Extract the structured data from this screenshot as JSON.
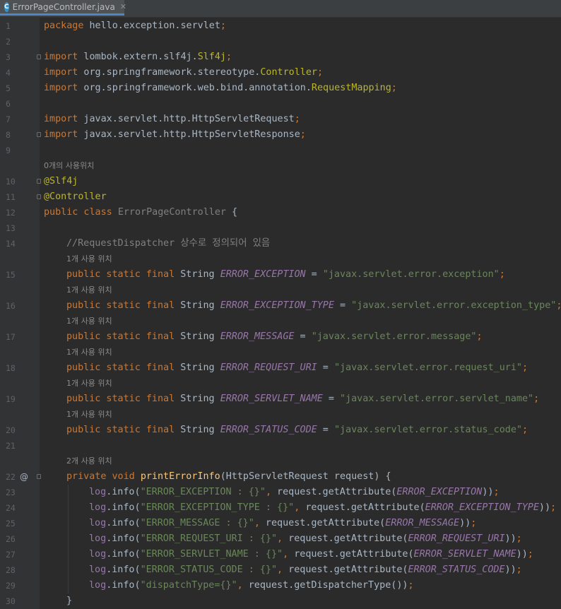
{
  "tab": {
    "filename": "ErrorPageController.java",
    "icon_letter": "C",
    "close_glyph": "✕"
  },
  "colors": {
    "editor_bg": "#2b2b2b",
    "keyword": "#cc7832",
    "string": "#6a8759",
    "constant": "#9876aa",
    "method": "#ffc66d",
    "annotation": "#bbb529"
  },
  "lines": [
    {
      "ln": "1",
      "tokens": [
        [
          "kw",
          "package"
        ],
        [
          "p",
          " hello.exception.servlet"
        ],
        [
          "kw",
          ";"
        ]
      ]
    },
    {
      "ln": "2",
      "tokens": []
    },
    {
      "ln": "3",
      "fold": true,
      "tokens": [
        [
          "kw",
          "import"
        ],
        [
          "p",
          " lombok.extern.slf4j."
        ],
        [
          "ann",
          "Slf4j"
        ],
        [
          "kw",
          ";"
        ]
      ]
    },
    {
      "ln": "4",
      "tokens": [
        [
          "kw",
          "import"
        ],
        [
          "p",
          " org.springframework.stereotype."
        ],
        [
          "ann",
          "Controller"
        ],
        [
          "kw",
          ";"
        ]
      ]
    },
    {
      "ln": "5",
      "tokens": [
        [
          "kw",
          "import"
        ],
        [
          "p",
          " org.springframework.web.bind.annotation."
        ],
        [
          "ann",
          "RequestMapping"
        ],
        [
          "kw",
          ";"
        ]
      ]
    },
    {
      "ln": "6",
      "tokens": []
    },
    {
      "ln": "7",
      "tokens": [
        [
          "kw",
          "import"
        ],
        [
          "p",
          " javax.servlet.http.HttpServletRequest"
        ],
        [
          "kw",
          ";"
        ]
      ]
    },
    {
      "ln": "8",
      "fold": true,
      "tokens": [
        [
          "kw",
          "import"
        ],
        [
          "p",
          " javax.servlet.http.HttpServletResponse"
        ],
        [
          "kw",
          ";"
        ]
      ]
    },
    {
      "ln": "9",
      "tokens": []
    },
    {
      "hint": "0개의 사용위치"
    },
    {
      "ln": "10",
      "fold": true,
      "tokens": [
        [
          "ann",
          "@Slf4j"
        ]
      ]
    },
    {
      "ln": "11",
      "fold": true,
      "tokens": [
        [
          "ann",
          "@Controller"
        ]
      ]
    },
    {
      "ln": "12",
      "tokens": [
        [
          "kw",
          "public class"
        ],
        [
          "p",
          " "
        ],
        [
          "dim",
          "ErrorPageController"
        ],
        [
          "p",
          " {"
        ]
      ]
    },
    {
      "ln": "13",
      "tokens": []
    },
    {
      "ln": "14",
      "indent": 1,
      "tokens": [
        [
          "cm",
          "//RequestDispatcher 상수로 정의되어 있음"
        ]
      ]
    },
    {
      "hint": "1개 사용 위치",
      "indent": 1
    },
    {
      "ln": "15",
      "indent": 1,
      "tokens": [
        [
          "kw",
          "public static final"
        ],
        [
          "p",
          " String "
        ],
        [
          "const",
          "ERROR_EXCEPTION"
        ],
        [
          "p",
          " = "
        ],
        [
          "str",
          "\"javax.servlet.error.exception\""
        ],
        [
          "kw",
          ";"
        ]
      ]
    },
    {
      "hint": "1개 사용 위치",
      "indent": 1
    },
    {
      "ln": "16",
      "indent": 1,
      "tokens": [
        [
          "kw",
          "public static final"
        ],
        [
          "p",
          " String "
        ],
        [
          "const",
          "ERROR_EXCEPTION_TYPE"
        ],
        [
          "p",
          " = "
        ],
        [
          "str",
          "\"javax.servlet.error.exception_type\""
        ],
        [
          "kw",
          ";"
        ]
      ]
    },
    {
      "hint": "1개 사용 위치",
      "indent": 1
    },
    {
      "ln": "17",
      "indent": 1,
      "tokens": [
        [
          "kw",
          "public static final"
        ],
        [
          "p",
          " String "
        ],
        [
          "const",
          "ERROR_MESSAGE"
        ],
        [
          "p",
          " = "
        ],
        [
          "str",
          "\"javax.servlet.error.message\""
        ],
        [
          "kw",
          ";"
        ]
      ]
    },
    {
      "hint": "1개 사용 위치",
      "indent": 1
    },
    {
      "ln": "18",
      "indent": 1,
      "tokens": [
        [
          "kw",
          "public static final"
        ],
        [
          "p",
          " String "
        ],
        [
          "const",
          "ERROR_REQUEST_URI"
        ],
        [
          "p",
          " = "
        ],
        [
          "str",
          "\"javax.servlet.error.request_uri\""
        ],
        [
          "kw",
          ";"
        ]
      ]
    },
    {
      "hint": "1개 사용 위치",
      "indent": 1
    },
    {
      "ln": "19",
      "indent": 1,
      "tokens": [
        [
          "kw",
          "public static final"
        ],
        [
          "p",
          " String "
        ],
        [
          "const",
          "ERROR_SERVLET_NAME"
        ],
        [
          "p",
          " = "
        ],
        [
          "str",
          "\"javax.servlet.error.servlet_name\""
        ],
        [
          "kw",
          ";"
        ]
      ]
    },
    {
      "hint": "1개 사용 위치",
      "indent": 1
    },
    {
      "ln": "20",
      "indent": 1,
      "tokens": [
        [
          "kw",
          "public static final"
        ],
        [
          "p",
          " String "
        ],
        [
          "const",
          "ERROR_STATUS_CODE"
        ],
        [
          "p",
          " = "
        ],
        [
          "str",
          "\"javax.servlet.error.status_code\""
        ],
        [
          "kw",
          ";"
        ]
      ]
    },
    {
      "ln": "21",
      "tokens": []
    },
    {
      "hint": "2개 사용 위치",
      "indent": 1
    },
    {
      "ln": "22",
      "at": "@",
      "fold": true,
      "indent": 1,
      "tokens": [
        [
          "kw",
          "private void"
        ],
        [
          "p",
          " "
        ],
        [
          "method",
          "printErrorInfo"
        ],
        [
          "p",
          "(HttpServletRequest request) {"
        ]
      ]
    },
    {
      "ln": "23",
      "indent": 2,
      "tokens": [
        [
          "field",
          "log"
        ],
        [
          "p",
          ".info("
        ],
        [
          "str",
          "\"ERROR_EXCEPTION : {}\""
        ],
        [
          "kw",
          ","
        ],
        [
          "p",
          " request.getAttribute("
        ],
        [
          "const",
          "ERROR_EXCEPTION"
        ],
        [
          "p",
          "))"
        ],
        [
          "kw",
          ";"
        ]
      ]
    },
    {
      "ln": "24",
      "indent": 2,
      "tokens": [
        [
          "field",
          "log"
        ],
        [
          "p",
          ".info("
        ],
        [
          "str",
          "\"ERROR_EXCEPTION_TYPE : {}\""
        ],
        [
          "kw",
          ","
        ],
        [
          "p",
          " request.getAttribute("
        ],
        [
          "const",
          "ERROR_EXCEPTION_TYPE"
        ],
        [
          "p",
          "))"
        ],
        [
          "kw",
          ";"
        ]
      ]
    },
    {
      "ln": "25",
      "indent": 2,
      "tokens": [
        [
          "field",
          "log"
        ],
        [
          "p",
          ".info("
        ],
        [
          "str",
          "\"ERROR_MESSAGE : {}\""
        ],
        [
          "kw",
          ","
        ],
        [
          "p",
          " request.getAttribute("
        ],
        [
          "const",
          "ERROR_MESSAGE"
        ],
        [
          "p",
          "))"
        ],
        [
          "kw",
          ";"
        ]
      ]
    },
    {
      "ln": "26",
      "indent": 2,
      "tokens": [
        [
          "field",
          "log"
        ],
        [
          "p",
          ".info("
        ],
        [
          "str",
          "\"ERROR_REQUEST_URI : {}\""
        ],
        [
          "kw",
          ","
        ],
        [
          "p",
          " request.getAttribute("
        ],
        [
          "const",
          "ERROR_REQUEST_URI"
        ],
        [
          "p",
          "))"
        ],
        [
          "kw",
          ";"
        ]
      ]
    },
    {
      "ln": "27",
      "indent": 2,
      "tokens": [
        [
          "field",
          "log"
        ],
        [
          "p",
          ".info("
        ],
        [
          "str",
          "\"ERROR_SERVLET_NAME : {}\""
        ],
        [
          "kw",
          ","
        ],
        [
          "p",
          " request.getAttribute("
        ],
        [
          "const",
          "ERROR_SERVLET_NAME"
        ],
        [
          "p",
          "))"
        ],
        [
          "kw",
          ";"
        ]
      ]
    },
    {
      "ln": "28",
      "indent": 2,
      "tokens": [
        [
          "field",
          "log"
        ],
        [
          "p",
          ".info("
        ],
        [
          "str",
          "\"ERROR_STATUS_CODE : {}\""
        ],
        [
          "kw",
          ","
        ],
        [
          "p",
          " request.getAttribute("
        ],
        [
          "const",
          "ERROR_STATUS_CODE"
        ],
        [
          "p",
          "))"
        ],
        [
          "kw",
          ";"
        ]
      ]
    },
    {
      "ln": "29",
      "indent": 2,
      "tokens": [
        [
          "field",
          "log"
        ],
        [
          "p",
          ".info("
        ],
        [
          "str",
          "\"dispatchType={}\""
        ],
        [
          "kw",
          ","
        ],
        [
          "p",
          " request.getDispatcherType())"
        ],
        [
          "kw",
          ";"
        ]
      ]
    },
    {
      "ln": "30",
      "indent": 1,
      "tokens": [
        [
          "p",
          "}"
        ]
      ]
    }
  ]
}
